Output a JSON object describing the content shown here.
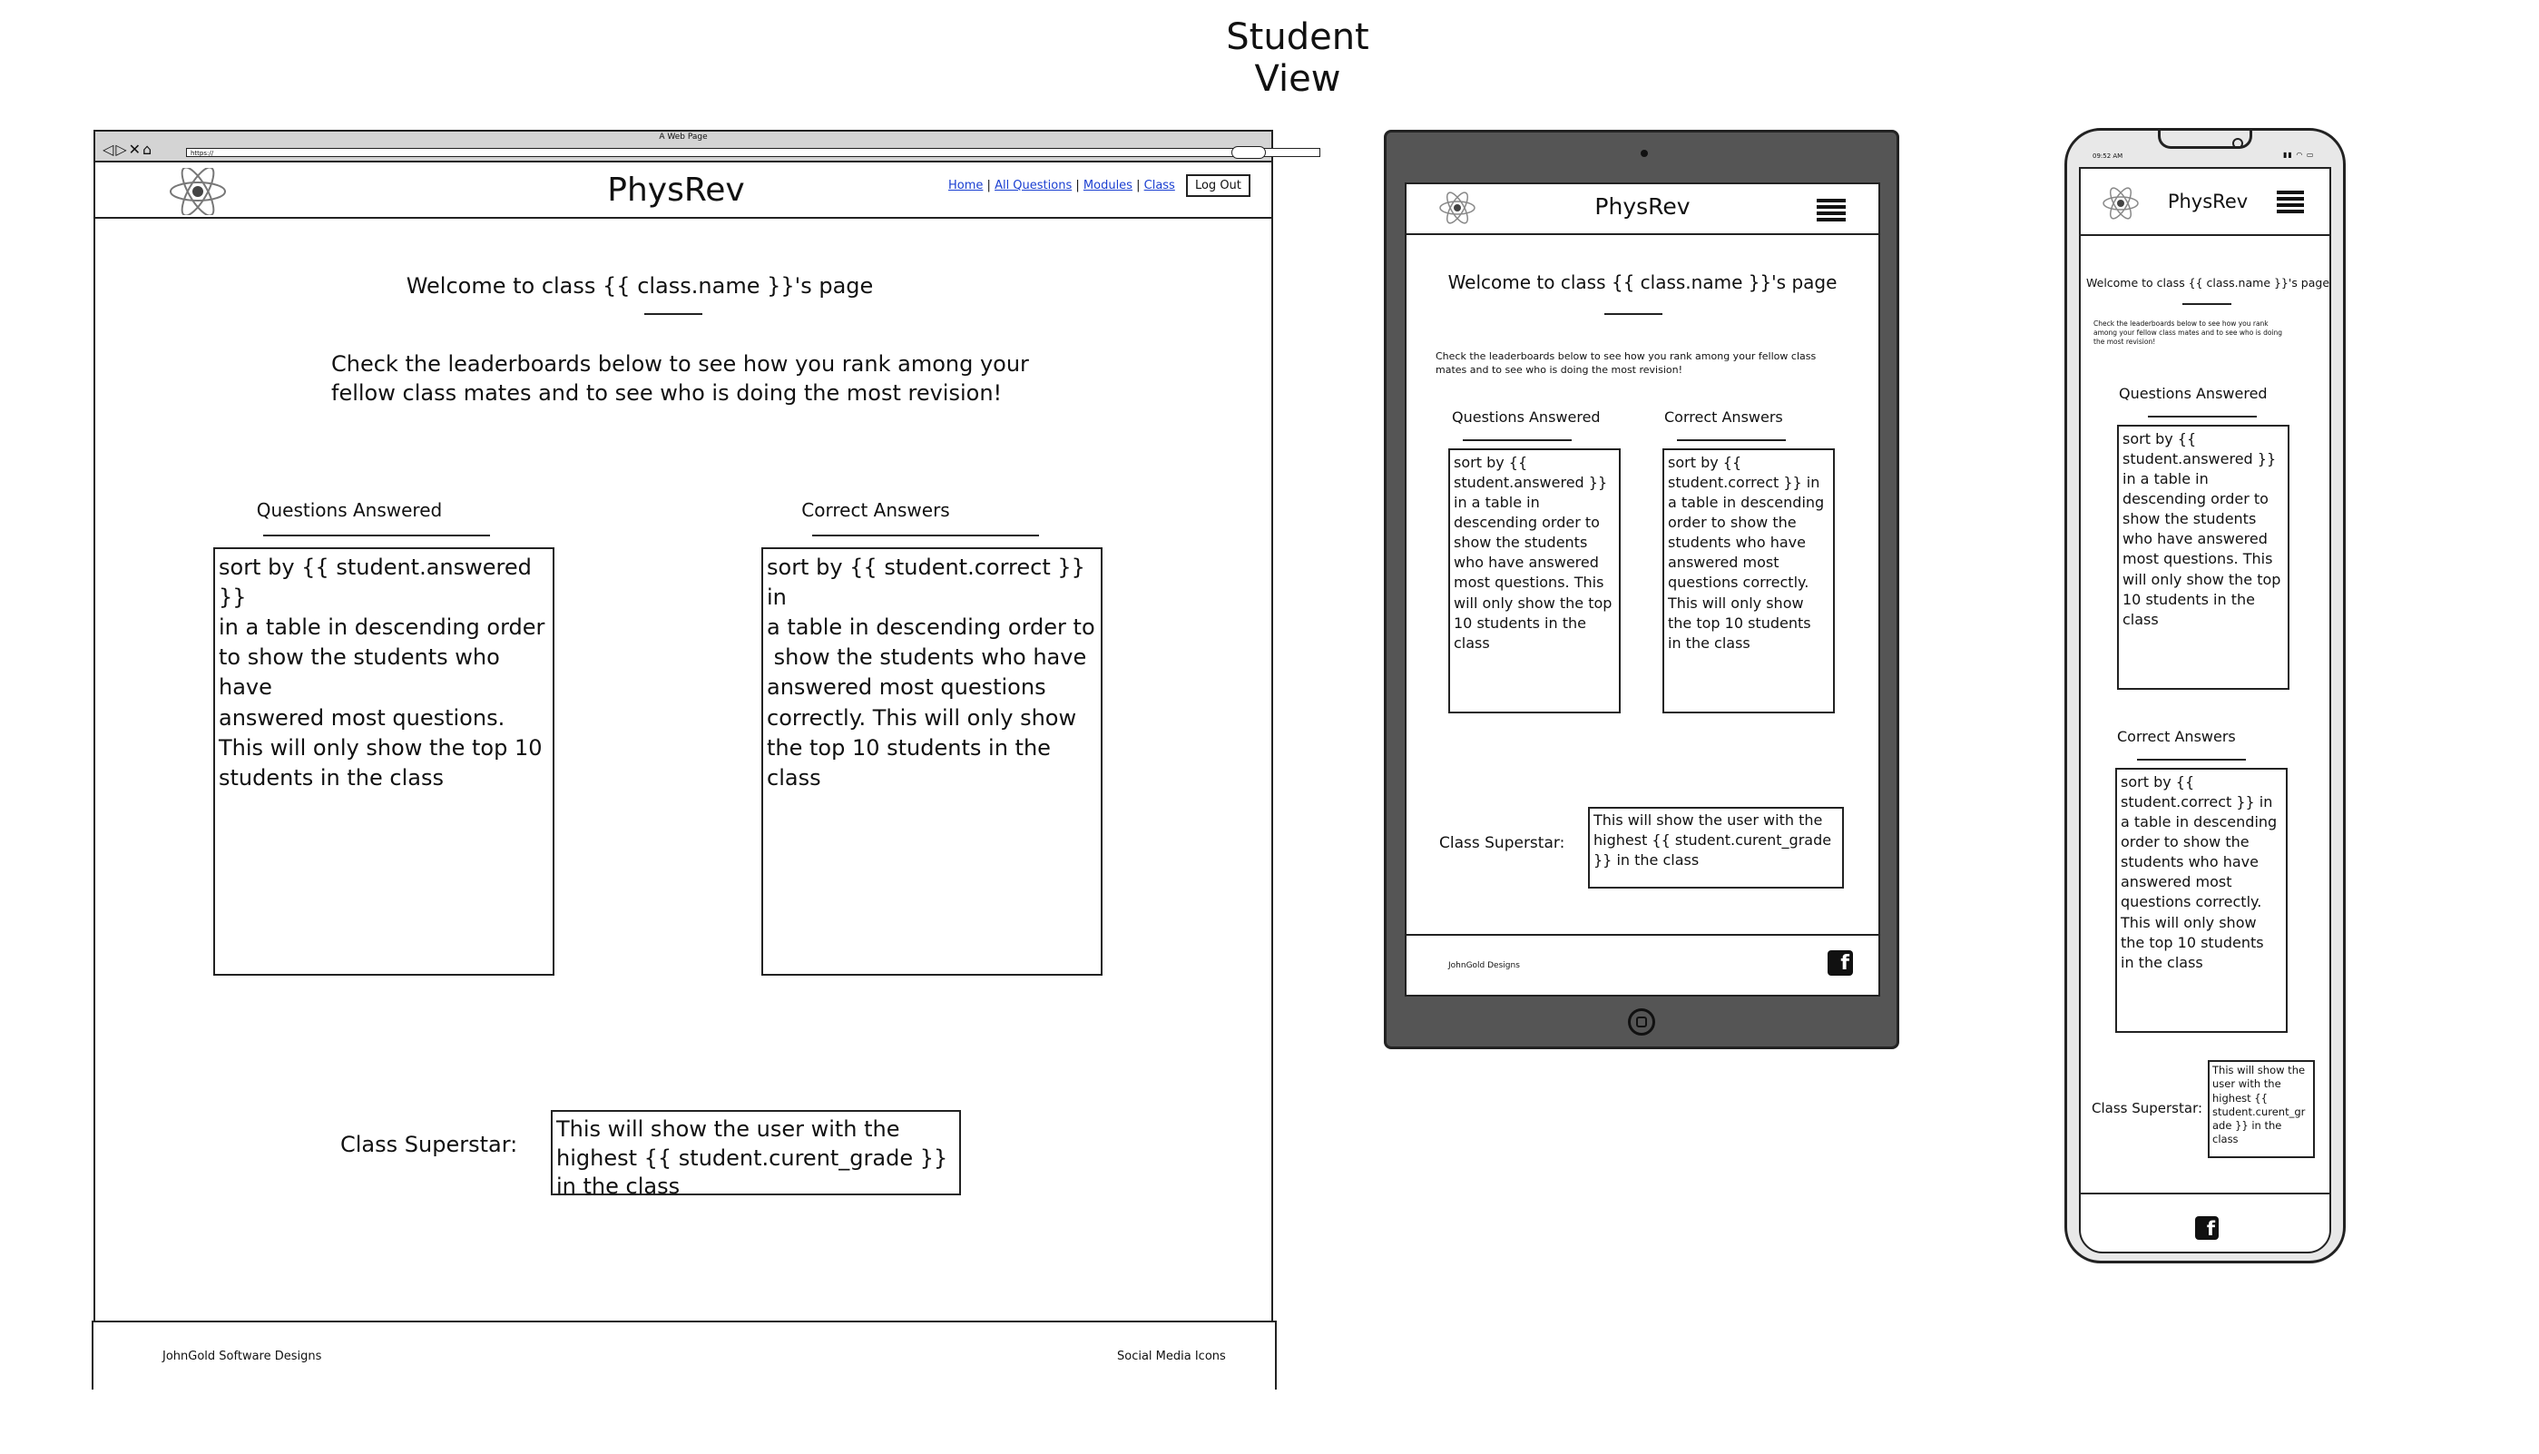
{
  "title": "Student View",
  "browser": {
    "window_title": "A Web Page",
    "url": "https://"
  },
  "brand": "PhysRev",
  "nav": {
    "home": "Home",
    "all_questions": "All Questions",
    "modules": "Modules",
    "class": "Class",
    "logout": "Log Out"
  },
  "desktop": {
    "welcome": "Welcome to class {{ class.name }}'s page",
    "intro": "Check the leaderboards below to see how you rank among your\nfellow class mates and to see who is doing the most revision!",
    "questions_heading": "Questions Answered",
    "questions_box": "sort by {{ student.answered }}\nin a table in descending order\nto show the students who have\nanswered most questions.\nThis will only show the top 10\nstudents in the class",
    "correct_heading": "Correct Answers",
    "correct_box": "sort by {{ student.correct }} in\na table in descending order to\n show the students who have\nanswered most questions\ncorrectly. This will only show\nthe top 10 students in the\nclass",
    "superstar_label": "Class Superstar:",
    "superstar_box": "This will show the user with the\nhighest {{ student.curent_grade }}\nin the class",
    "footer_left": "JohnGold Software Designs",
    "footer_right": "Social Media Icons"
  },
  "tablet": {
    "welcome": "Welcome to class {{ class.name }}'s page",
    "intro": "Check the leaderboards below to see how you rank among your fellow class\nmates and to see who is doing the most revision!",
    "questions_heading": "Questions Answered",
    "questions_box": "sort by {{\nstudent.answered }}\nin a table in\ndescending order to\nshow the students\nwho have answered\nmost questions. This\nwill only show the top\n10 students in the\nclass",
    "correct_heading": "Correct Answers",
    "correct_box": "sort by {{\nstudent.correct }} in\na table in descending\norder to show the\nstudents who have\nanswered most\nquestions correctly.\nThis will only show\nthe top 10 students\nin the class",
    "superstar_label": "Class Superstar:",
    "superstar_box": "This will show the user with the\nhighest {{ student.curent_grade\n}} in the class",
    "footer_left": "JohnGold Designs"
  },
  "phone": {
    "status_time": "09:52 AM",
    "welcome": "Welcome to class {{ class.name }}'s page",
    "intro": "Check the leaderboards below to see how you rank\namong your fellow class mates and to see who is doing\nthe most revision!",
    "questions_heading": "Questions Answered",
    "questions_box": "sort by {{\nstudent.answered }}\nin a table in\ndescending order to\nshow the students\nwho have answered\nmost questions. This\nwill only show the top\n10 students in the\nclass",
    "correct_heading": "Correct Answers",
    "correct_box": "sort by {{\nstudent.correct }} in\na table in descending\norder to show the\nstudents who have\nanswered most\nquestions correctly.\nThis will only show\nthe top 10 students\nin the class",
    "superstar_label": "Class Superstar:",
    "superstar_box": "This will show the\nuser with the\nhighest {{\nstudent.curent_gr\nade }} in the\nclass"
  },
  "icons": {
    "logo": "atom-logo-icon",
    "menu": "hamburger-menu-icon",
    "facebook": "facebook-icon",
    "home_button": "home-button-icon"
  }
}
